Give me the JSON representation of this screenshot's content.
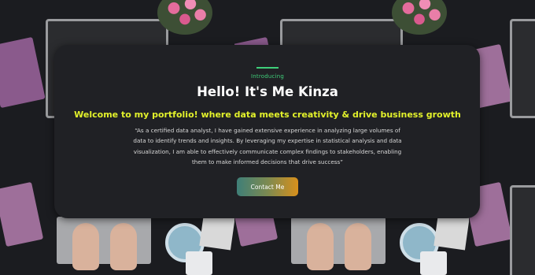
{
  "hero": {
    "kicker": "Introducing",
    "headline": "Hello! It's Me Kinza",
    "tagline": "Welcome to my portfolio! where data meets creativity & drive business growth",
    "bio": "“As a certified data analyst, I have gained extensive experience in analyzing large volumes of data to identify trends and insights. By leveraging my expertise in statistical analysis and data visualization, I am able to effectively communicate complex findings to stakeholders, enabling them to make informed decisions that drive success”",
    "cta_label": "Contact Me"
  },
  "colors": {
    "card_background": "#202125",
    "accent_green": "#3fcf7a",
    "tagline_yellow": "#e3f22b",
    "cta_gradient_start": "#3f7f78",
    "cta_gradient_end": "#d8901c"
  }
}
